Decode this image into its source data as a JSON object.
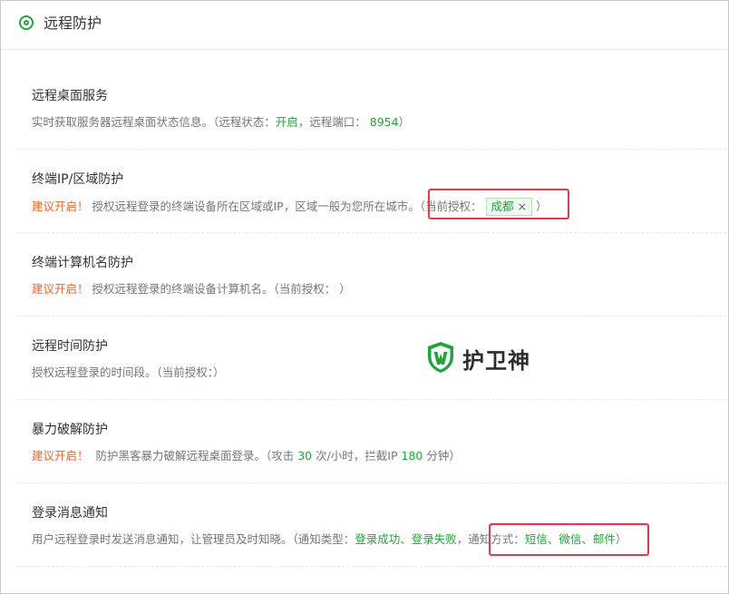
{
  "header": {
    "title": "远程防护"
  },
  "sections": [
    {
      "title": "远程桌面服务",
      "desc_prefix": "实时获取服务器远程桌面状态信息。（远程状态：",
      "status": "开启",
      "desc_mid": "，远程端口：",
      "port": "8954",
      "desc_suffix": "）"
    },
    {
      "title": "终端IP/区域防护",
      "warn": "建议开启！",
      "desc": "授权远程登录的终端设备所在区域或IP，区域一般为您所在城市。",
      "auth_label": "（当前授权：",
      "tag": "成都",
      "tag_close": "×",
      "auth_end": "）"
    },
    {
      "title": "终端计算机名防护",
      "warn": "建议开启！",
      "desc": "授权远程登录的终端设备计算机名。（当前授权：   ）"
    },
    {
      "title": "远程时间防护",
      "desc": "授权远程登录的时间段。（当前授权：）"
    },
    {
      "title": "暴力破解防护",
      "warn": "建议开启！",
      "desc_prefix": "防护黑客暴力破解远程桌面登录。（攻击 ",
      "attacks": "30",
      "desc_mid": " 次/小时，拦截IP ",
      "block_min": "180",
      "desc_suffix": " 分钟）"
    },
    {
      "title": "登录消息通知",
      "desc_prefix": "用户远程登录时发送消息通知，让管理员及时知晓。（通知类型：",
      "types": "登录成功、登录失败",
      "sep": "，",
      "method_label": "通知方式：",
      "methods": "短信、微信、邮件",
      "end": "）"
    }
  ],
  "watermark": {
    "text": "护卫神",
    "icon": "shield-w-logo"
  },
  "colors": {
    "accent": "#20a53a",
    "warning": "#f0642c",
    "highlight": "#e8384f"
  }
}
